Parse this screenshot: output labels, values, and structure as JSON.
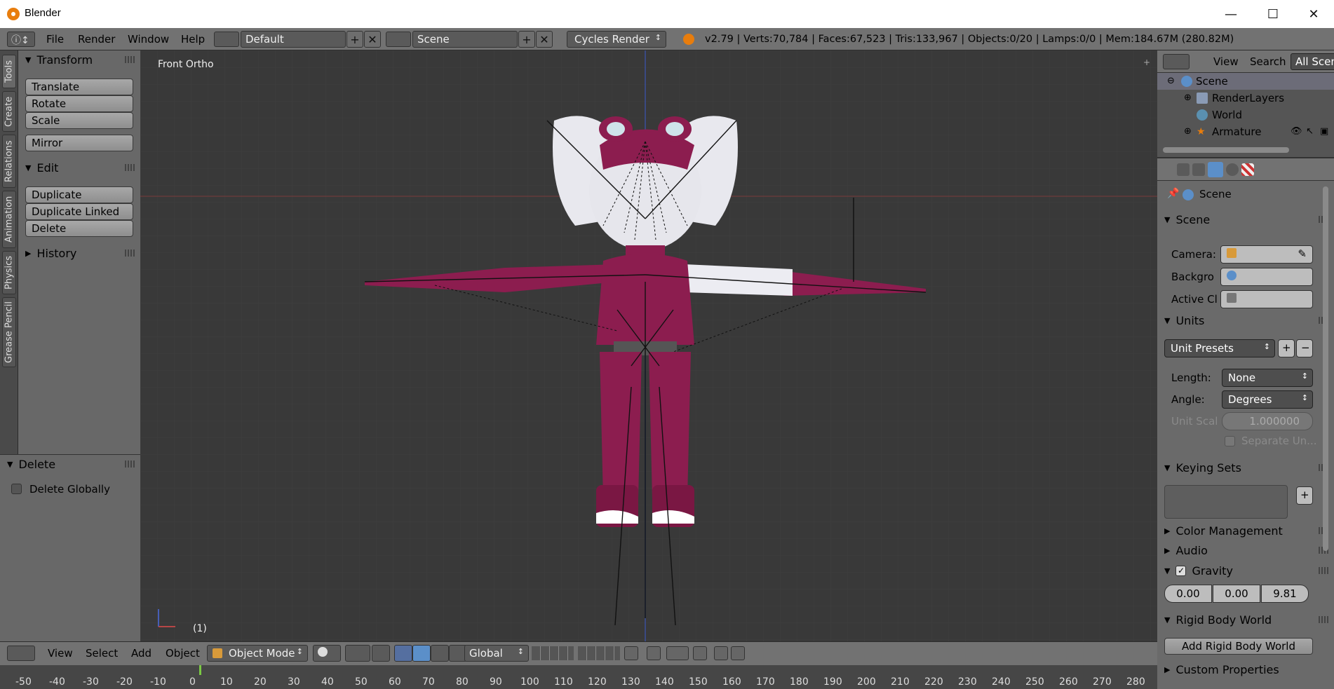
{
  "window": {
    "title": "Blender"
  },
  "topbar": {
    "menu": [
      "File",
      "Render",
      "Window",
      "Help"
    ],
    "layout": "Default",
    "scene": "Scene",
    "engine": "Cycles Render",
    "stats": "v2.79 | Verts:70,784 | Faces:67,523 | Tris:133,967 | Objects:0/20 | Lamps:0/0 | Mem:184.67M (280.82M)"
  },
  "lefttabs": [
    "Tools",
    "Create",
    "Relations",
    "Animation",
    "Physics",
    "Grease Pencil"
  ],
  "toolpanel": {
    "transform_title": "Transform",
    "transform": [
      "Translate",
      "Rotate",
      "Scale"
    ],
    "mirror": "Mirror",
    "edit_title": "Edit",
    "edit": [
      "Duplicate",
      "Duplicate Linked",
      "Delete"
    ],
    "history_title": "History"
  },
  "ops": {
    "title": "Delete",
    "checkbox": "Delete Globally"
  },
  "viewport": {
    "view_label": "Front Ortho",
    "frame": "(1)"
  },
  "outliner": {
    "menu": [
      "View",
      "Search"
    ],
    "filter": "All Scenes",
    "items": [
      "Scene",
      "RenderLayers",
      "World",
      "Armature"
    ]
  },
  "props": {
    "context": "Scene",
    "scene_section": "Scene",
    "camera_label": "Camera:",
    "background_label": "Backgro",
    "active_clip_label": "Active Cl",
    "units_section": "Units",
    "unit_presets": "Unit Presets",
    "length_label": "Length:",
    "length_value": "None",
    "angle_label": "Angle:",
    "angle_value": "Degrees",
    "unit_scale_label": "Unit Scal",
    "unit_scale_value": "1.000000",
    "separate_units": "Separate Un...",
    "keying_sets": "Keying Sets",
    "color_management": "Color Management",
    "audio": "Audio",
    "gravity": "Gravity",
    "gravity_values": [
      "0.00",
      "0.00",
      "9.81"
    ],
    "rigid_body": "Rigid Body World",
    "add_rigid": "Add Rigid Body World",
    "custom_props": "Custom Properties"
  },
  "bottombar": {
    "menu": [
      "View",
      "Select",
      "Add",
      "Object"
    ],
    "mode": "Object Mode",
    "orientation": "Global"
  },
  "timeline": {
    "ticks": [
      "-50",
      "-40",
      "-30",
      "-20",
      "-10",
      "0",
      "10",
      "20",
      "30",
      "40",
      "50",
      "60",
      "70",
      "80",
      "90",
      "100",
      "110",
      "120",
      "130",
      "140",
      "150",
      "160",
      "170",
      "180",
      "190",
      "200",
      "210",
      "220",
      "230",
      "240",
      "250",
      "260",
      "270",
      "280"
    ]
  },
  "colors": {
    "accent": "#e87d0d",
    "character_main": "#8c1d4f",
    "character_light": "#e8e8ee",
    "viewport_bg": "#393939"
  }
}
